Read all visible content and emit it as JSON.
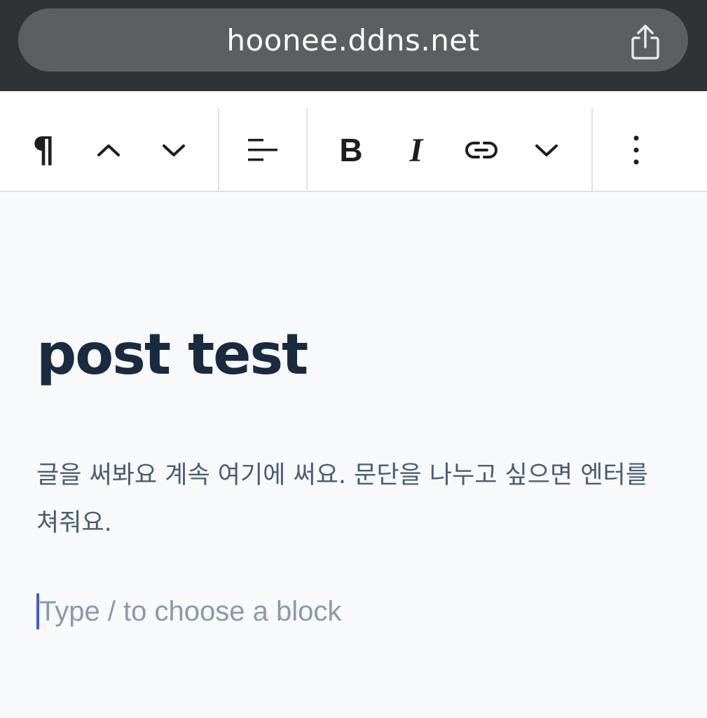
{
  "browser": {
    "url": "hoonee.ddns.net",
    "share_icon": "share-icon"
  },
  "toolbar": {
    "items": [
      {
        "name": "paragraph-icon",
        "label": "¶"
      },
      {
        "name": "move-up-icon"
      },
      {
        "name": "move-down-icon"
      },
      {
        "name": "align-icon"
      },
      {
        "name": "bold-icon",
        "label": "B"
      },
      {
        "name": "italic-icon",
        "label": "I"
      },
      {
        "name": "link-icon"
      },
      {
        "name": "more-formatting-chevron-icon"
      },
      {
        "name": "options-kebab-icon"
      }
    ]
  },
  "post": {
    "title": "post test",
    "body": "글을 써봐요 계속 여기에 써요. 문단을 나누고 싶으면 엔터를 쳐줘요.",
    "placeholder": "Type / to choose a block"
  },
  "colors": {
    "browser_bar": "#303335",
    "url_pill": "#5c5f61",
    "title": "#1a2b40",
    "body_text": "#4a5d73",
    "placeholder": "#8c99aa",
    "caret": "#3d5be0"
  }
}
